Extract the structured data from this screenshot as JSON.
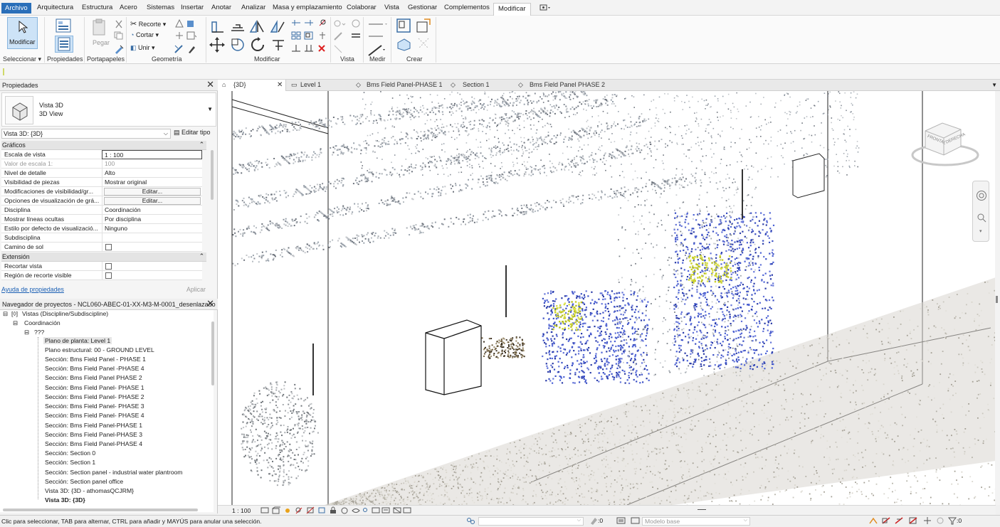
{
  "menu": {
    "items": [
      "Archivo",
      "Arquitectura",
      "Estructura",
      "Acero",
      "Sistemas",
      "Insertar",
      "Anotar",
      "Analizar",
      "Masa y emplazamiento",
      "Colaborar",
      "Vista",
      "Gestionar",
      "Complementos",
      "Modificar"
    ]
  },
  "ribbon": {
    "modify_label": "Modificar",
    "select_label": "Seleccionar",
    "groups": {
      "propiedades": "Propiedades",
      "portapapeles": "Portapapeles",
      "geometria": "Geometría",
      "modificar": "Modificar",
      "vista": "Vista",
      "medir": "Medir",
      "crear": "Crear"
    },
    "paste_label": "Pegar",
    "recorte_label": "Recorte",
    "cortar_label": "Cortar",
    "unir_label": "Unir"
  },
  "properties": {
    "title": "Propiedades",
    "type_name": "Vista 3D",
    "type_sub": "3D View",
    "selector": "Vista 3D: {3D}",
    "edit_type": "Editar tipo",
    "section_graphics": "Gráficos",
    "rows": [
      {
        "name": "Escala de vista",
        "value": "1 : 100"
      },
      {
        "name": "Valor de escala    1:",
        "value": "100"
      },
      {
        "name": "Nivel de detalle",
        "value": "Alto"
      },
      {
        "name": "Visibilidad de piezas",
        "value": "Mostrar original"
      },
      {
        "name": "Modificaciones de visibilidad/gr...",
        "value": "Editar..."
      },
      {
        "name": "Opciones de visualización de grá...",
        "value": "Editar..."
      },
      {
        "name": "Disciplina",
        "value": "Coordinación"
      },
      {
        "name": "Mostrar líneas ocultas",
        "value": "Por disciplina"
      },
      {
        "name": "Estilo por defecto de visualizació...",
        "value": "Ninguno"
      },
      {
        "name": "Subdisciplina",
        "value": ""
      },
      {
        "name": "Camino de sol",
        "value": ""
      }
    ],
    "section_extent": "Extensión",
    "extent_rows": [
      {
        "name": "Recortar vista",
        "value": ""
      },
      {
        "name": "Región de recorte visible",
        "value": ""
      }
    ],
    "help_link": "Ayuda de propiedades",
    "apply": "Aplicar"
  },
  "browser": {
    "title": "Navegador de proyectos - NCL060-ABEC-01-XX-M3-M-0001_desenlazado",
    "root": "Vistas (Discipline/Subdiscipline)",
    "coord": "Coordinación",
    "unknown": "???",
    "items": [
      "Plano de planta: Level 1",
      "Plano estructural: 00 - GROUND LEVEL",
      "Sección: Bms Field Panel - PHASE 1",
      "Sección: Bms Field Panel -PHASE 4",
      "Sección: Bms Field Panel PHASE 2",
      "Sección: Bms Field Panel- PHASE 1",
      "Sección: Bms Field Panel- PHASE 2",
      "Sección: Bms Field Panel- PHASE 3",
      "Sección: Bms Field Panel- PHASE 4",
      "Sección: Bms Field Panel-PHASE 1",
      "Sección: Bms Field Panel-PHASE 3",
      "Sección: Bms Field Panel-PHASE 4",
      "Sección: Section 0",
      "Sección: Section 1",
      "Sección: Section panel - industrial water plantroom",
      "Sección: Section panel office",
      "Vista 3D: {3D - athomasQCJRM}",
      "Vista 3D: {3D}"
    ]
  },
  "view_tabs": [
    "{3D}",
    "Level 1",
    "Bms Field Panel-PHASE 1",
    "Section 1",
    "Bms Field Panel PHASE 2"
  ],
  "viewcube": {
    "front": "FRONTAL",
    "right": "DERECHA"
  },
  "view_scale": "1 : 100",
  "status": {
    "message": "Clic para seleccionar, TAB para alternar, CTRL para añadir y MAYÚS para anular una selección.",
    "zero": ":0",
    "model": "Modelo base",
    "filter_count": ":0"
  },
  "colors": {
    "accent": "#2a6fb9",
    "equipment": "#3a4fc4",
    "equipment_highlight": "#c8d02a"
  }
}
